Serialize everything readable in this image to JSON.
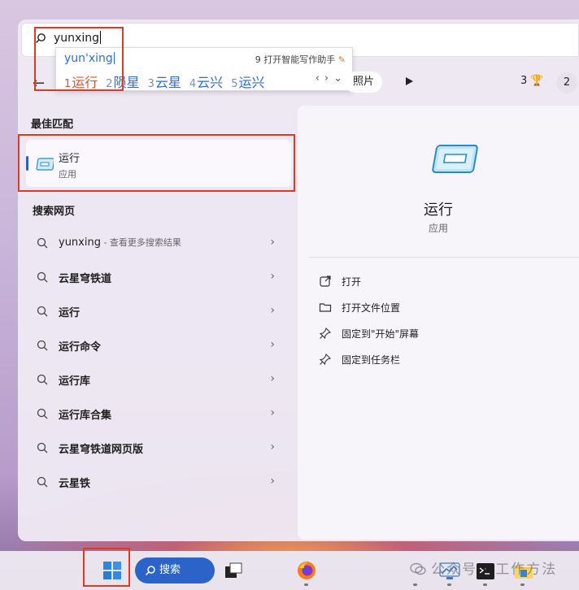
{
  "search": {
    "query": "yunxing"
  },
  "ime": {
    "pinyin": "yun'xing",
    "assistant": "9 打开智能写作助手",
    "candidates": [
      {
        "num": "1",
        "text": "运行"
      },
      {
        "num": "2",
        "text": "陨星"
      },
      {
        "num": "3",
        "text": "云星"
      },
      {
        "num": "4",
        "text": "云兴"
      },
      {
        "num": "5",
        "text": "运兴"
      }
    ],
    "arrows": "‹›⌄"
  },
  "filters": {
    "photos_label": "照片",
    "count": "3"
  },
  "profile": {
    "avatar": "2"
  },
  "best_match": {
    "section": "最佳匹配",
    "title": "运行",
    "subtitle": "应用"
  },
  "web": {
    "section": "搜索网页",
    "items": [
      {
        "text": "yunxing",
        "hint": " - 查看更多搜索结果"
      },
      {
        "text": "云星穹铁道",
        "hint": ""
      },
      {
        "text": "运行",
        "hint": ""
      },
      {
        "text": "运行命令",
        "hint": ""
      },
      {
        "text": "运行库",
        "hint": ""
      },
      {
        "text": "运行库合集",
        "hint": ""
      },
      {
        "text": "云星穹铁道网页版",
        "hint": ""
      },
      {
        "text": "云星铁",
        "hint": ""
      }
    ]
  },
  "detail": {
    "title": "运行",
    "subtitle": "应用",
    "actions": [
      {
        "icon": "open-icon",
        "label": "打开"
      },
      {
        "icon": "folder-icon",
        "label": "打开文件位置"
      },
      {
        "icon": "pin-icon",
        "label": "固定到\"开始\"屏幕"
      },
      {
        "icon": "pin-icon",
        "label": "固定到任务栏"
      }
    ]
  },
  "taskbar": {
    "search_label": "搜索"
  },
  "watermark": "公众号 · 工作方法",
  "colors": {
    "accent": "#2b63c8",
    "highlight": "#e0391f",
    "ime_first": "#e2502e"
  }
}
